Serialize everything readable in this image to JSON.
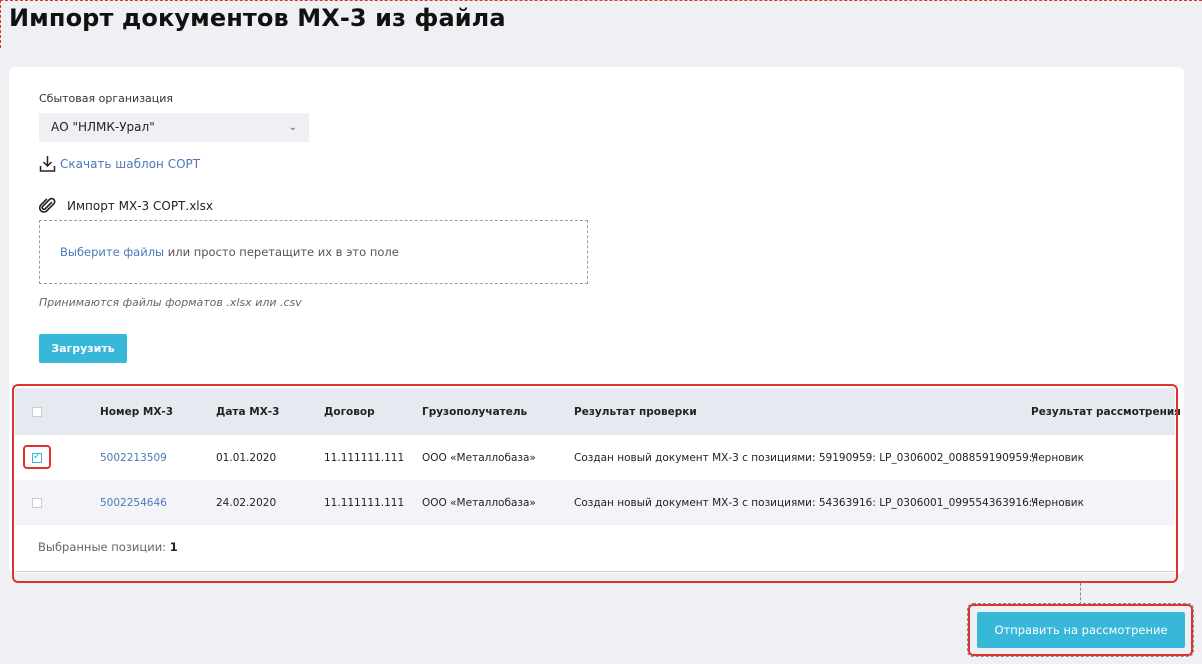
{
  "page": {
    "title": "Импорт документов МХ-3 из файла"
  },
  "form": {
    "org_label": "Сбытовая организация",
    "org_value": "АО \"НЛМК-Урал\"",
    "download_template": "Скачать шаблон СОРТ",
    "attached_file": "Импорт МХ-3 СОРТ.xlsx",
    "dropzone_pick": "Выберите файлы",
    "dropzone_rest": " или просто перетащите их в это поле",
    "formats_hint": "Принимаются файлы форматов .xlsx или .csv",
    "upload_button": "Загрузить"
  },
  "table": {
    "columns": [
      "Номер МХ-3",
      "Дата МХ-3",
      "Договор",
      "Грузополучатель",
      "Результат проверки",
      "Результат рассмотрения"
    ],
    "rows": [
      {
        "checked": true,
        "number": "5002213509",
        "date": "01.01.2020",
        "contract": "11.111111.111",
        "consignee": "ООО «Металлобаза»",
        "check_result": "Создан новый документ МХ-3 с позициями: 59190959: LP_0306002_008859190959:/",
        "review_result": "Черновик"
      },
      {
        "checked": false,
        "number": "5002254646",
        "date": "24.02.2020",
        "contract": "11.111111.111",
        "consignee": "ООО «Металлобаза»",
        "check_result": "Создан новый документ МХ-3 с позициями: 54363916: LP_0306001_099554363916:/",
        "review_result": "Черновик"
      }
    ],
    "selected_label": "Выбранные позиции: ",
    "selected_count": "1"
  },
  "actions": {
    "submit_button": "Отправить на рассмотрение"
  },
  "colors": {
    "accent": "#37b8d9",
    "link": "#4b79b8",
    "highlight": "#e0312e"
  },
  "icons": {
    "download": "download-icon",
    "attachment": "paperclip-icon",
    "select": "chevron-down-icon",
    "checkbox_checked": "checkmark-icon"
  }
}
